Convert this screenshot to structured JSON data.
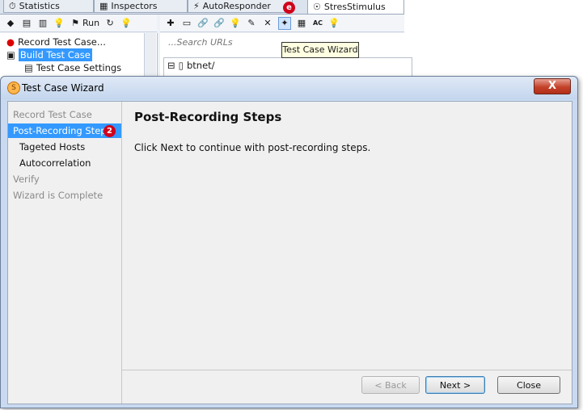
{
  "app": {
    "tabs": [
      {
        "label": "Statistics",
        "icon": "stopwatch-icon"
      },
      {
        "label": "Inspectors",
        "icon": "inspector-icon"
      },
      {
        "label": "AutoResponder",
        "icon": "lightning-icon"
      },
      {
        "label": "StresStimulus",
        "icon": "stresstimulus-icon"
      }
    ],
    "toolbar": {
      "run_label": "Run"
    },
    "tree": [
      {
        "label": "Record Test Case..."
      },
      {
        "label": "Build Test Case"
      },
      {
        "label": "Test Case Settings"
      }
    ],
    "search_placeholder": "...Search URLs",
    "url_root": "btnet/",
    "tooltip": "Test Case Wizard",
    "badge_top": "e"
  },
  "dialog": {
    "title": "Test Case Wizard",
    "close": "X",
    "steps": [
      {
        "label": "Record Test Case"
      },
      {
        "label": "Post-Recording Steps"
      },
      {
        "label": "Tageted Hosts"
      },
      {
        "label": "Autocorrelation"
      },
      {
        "label": "Verify"
      },
      {
        "label": "Wizard is Complete"
      }
    ],
    "step_badge": "2",
    "header": "Post-Recording Steps",
    "body": "Click Next to continue with post-recording steps.",
    "buttons": {
      "back": "< Back",
      "next": "Next >",
      "close": "Close"
    }
  }
}
